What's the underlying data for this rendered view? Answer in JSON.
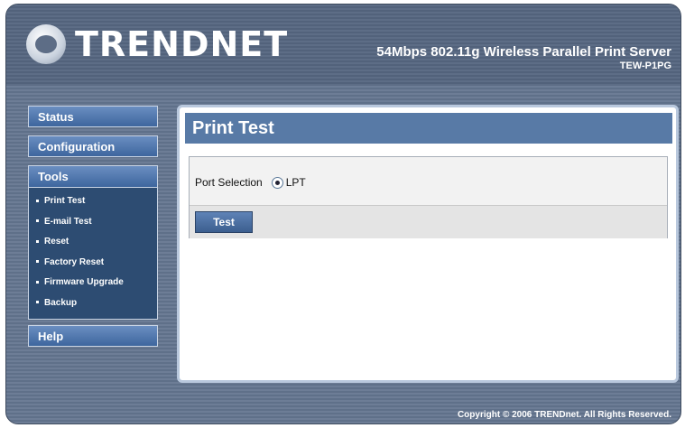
{
  "header": {
    "brand": "TRENDNET",
    "product_title": "54Mbps 802.11g Wireless Parallel Print Server",
    "model": "TEW-P1PG"
  },
  "sidebar": {
    "status_label": "Status",
    "configuration_label": "Configuration",
    "tools_label": "Tools",
    "tools_items": [
      "Print Test",
      "E-mail Test",
      "Reset",
      "Factory Reset",
      "Firmware Upgrade",
      "Backup"
    ],
    "help_label": "Help"
  },
  "main": {
    "title": "Print Test",
    "port_selection_label": "Port Selection",
    "port_option": "LPT",
    "test_button": "Test"
  },
  "footer": {
    "copyright": "Copyright © 2006 TRENDnet. All Rights Reserved."
  }
}
